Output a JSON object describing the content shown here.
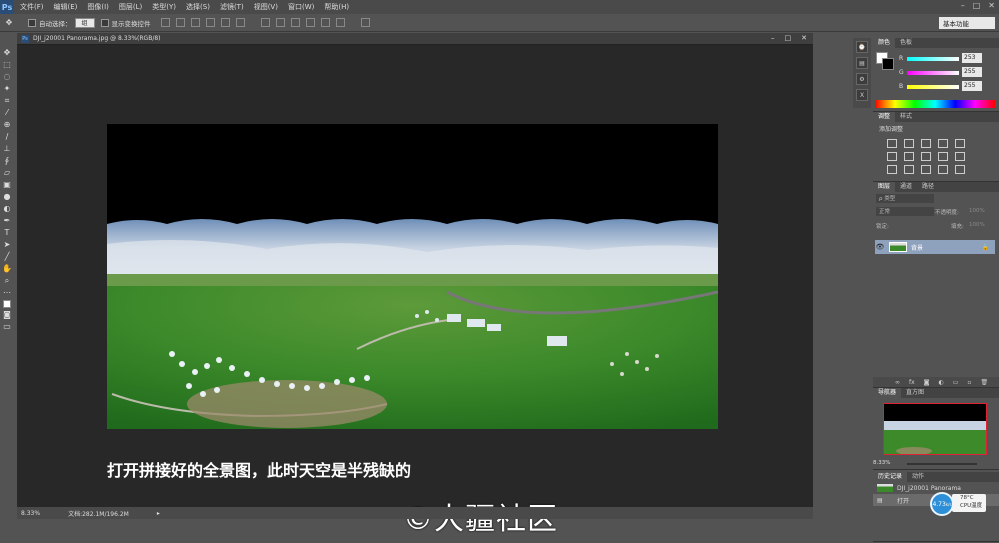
{
  "app": {
    "logo": "Ps"
  },
  "menubar": {
    "items": [
      "文件(F)",
      "编辑(E)",
      "图像(I)",
      "图层(L)",
      "类型(Y)",
      "选择(S)",
      "滤镜(T)",
      "视图(V)",
      "窗口(W)",
      "帮助(H)"
    ],
    "window_controls": {
      "minimize": "–",
      "maximize": "□",
      "close": "✕"
    }
  },
  "options": {
    "auto_select_label": "自动选择：",
    "auto_select_value": "组",
    "show_transform_label": "显示变换控件",
    "workspace": "基本功能"
  },
  "document": {
    "tab_title": "DJI_j20001 Panorama.jpg @ 8.33%(RGB/8)",
    "zoom": "8.33%",
    "doc_info": "文档:282.1M/196.2M"
  },
  "content": {
    "caption": "打开拼接好的全景图，此时天空是半残缺的",
    "watermark": "©大疆社区"
  },
  "color_panel": {
    "tabs": [
      "颜色",
      "色板"
    ],
    "channels": [
      {
        "label": "R",
        "value": "253"
      },
      {
        "label": "G",
        "value": "255"
      },
      {
        "label": "B",
        "value": "255"
      }
    ]
  },
  "adjustments_panel": {
    "tabs": [
      "调整",
      "样式"
    ],
    "subtitle": "添加调整"
  },
  "layers_panel": {
    "tabs": [
      "图层",
      "通道",
      "路径"
    ],
    "kind_label": "ρ 类型",
    "blend_mode": "正常",
    "opacity_label": "不透明度:",
    "opacity_value": "100%",
    "lock_label": "锁定:",
    "fill_label": "填充:",
    "fill_value": "100%",
    "layer_name": "背景"
  },
  "navigator_panel": {
    "tabs": [
      "导航器",
      "直方图"
    ],
    "zoom": "8.33%"
  },
  "history_panel": {
    "tabs": [
      "历史记录",
      "动作"
    ],
    "items": [
      "DJI_j20001 Panorama",
      "打开"
    ]
  },
  "cpu_widget": {
    "speed": "4.73",
    "unit": "k/s",
    "temperature": "78°C",
    "label": "CPU温度"
  },
  "colors": {
    "ui_dark": "#535353",
    "canvas_bg": "#282828",
    "accent_blue": "#2d8fd8",
    "layer_selected": "#8ea1bd"
  }
}
